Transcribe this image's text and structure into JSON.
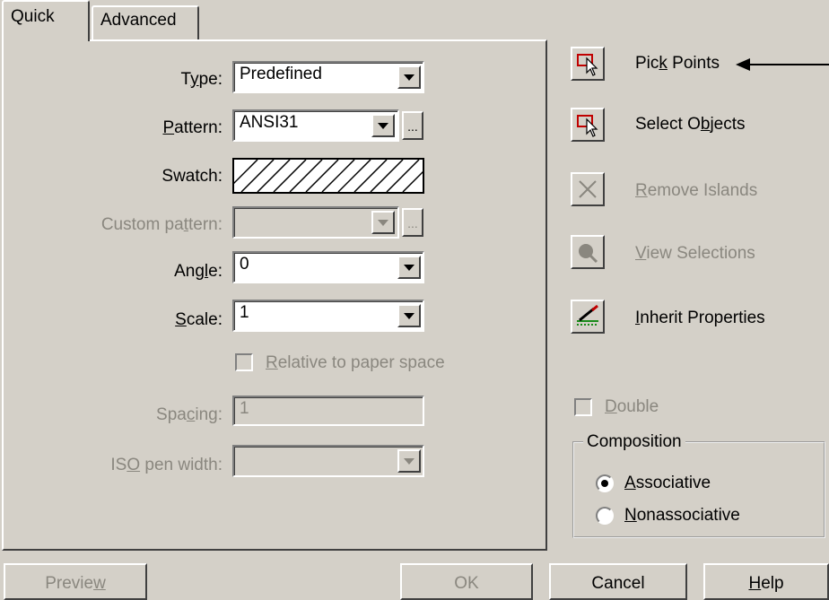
{
  "tabs": [
    {
      "label": "Quick",
      "active": true
    },
    {
      "label": "Advanced",
      "active": false
    }
  ],
  "type": {
    "label_pre": "T",
    "label_mn": "y",
    "label_post": "pe:",
    "value": "Predefined"
  },
  "pattern": {
    "label_mn": "P",
    "label_post": "attern:",
    "value": "ANSI31"
  },
  "swatch": {
    "label": "Swatch:"
  },
  "custom_pattern": {
    "label_pre": "Custom pa",
    "label_mn": "t",
    "label_post": "tern:",
    "value": ""
  },
  "angle": {
    "label_pre": "Ang",
    "label_mn": "l",
    "label_post": "e:",
    "value": "0"
  },
  "scale": {
    "label_mn": "S",
    "label_post": "cale:",
    "value": "1"
  },
  "relative": {
    "label_mn": "R",
    "label_post": "elative to paper space",
    "checked": false
  },
  "spacing": {
    "label_pre": "Spa",
    "label_mn": "c",
    "label_post": "ing:",
    "value": "1"
  },
  "iso_pen": {
    "label_pre": "IS",
    "label_mn": "O",
    "label_post": " pen width:",
    "value": ""
  },
  "side_buttons": {
    "pick": {
      "pre": "Pic",
      "mn": "k",
      "post": " Points",
      "icon": "pick-points-icon"
    },
    "select": {
      "pre": "Select O",
      "mn": "b",
      "post": "jects",
      "icon": "select-objects-icon"
    },
    "remove": {
      "mn": "R",
      "post": "emove Islands",
      "icon": "remove-islands-icon"
    },
    "view": {
      "mn": "V",
      "post": "iew Selections",
      "icon": "view-selections-icon"
    },
    "inherit": {
      "mn": "I",
      "post": "nherit Properties",
      "icon": "inherit-properties-icon"
    }
  },
  "double": {
    "mn": "D",
    "post": "ouble",
    "checked": false
  },
  "composition": {
    "title": "Composition",
    "associative": {
      "mn": "A",
      "post": "ssociative",
      "selected": true
    },
    "nonassociative": {
      "mn": "N",
      "post": "onassociative",
      "selected": false
    }
  },
  "footer": {
    "preview": {
      "pre": "Previe",
      "mn": "w",
      "post": ""
    },
    "ok": "OK",
    "cancel": "Cancel",
    "help": {
      "mn": "H",
      "post": "elp"
    }
  },
  "colors": {
    "dialog_bg": "#d4d0c8",
    "disabled_text": "#8a877f",
    "arrow": "#000000"
  }
}
